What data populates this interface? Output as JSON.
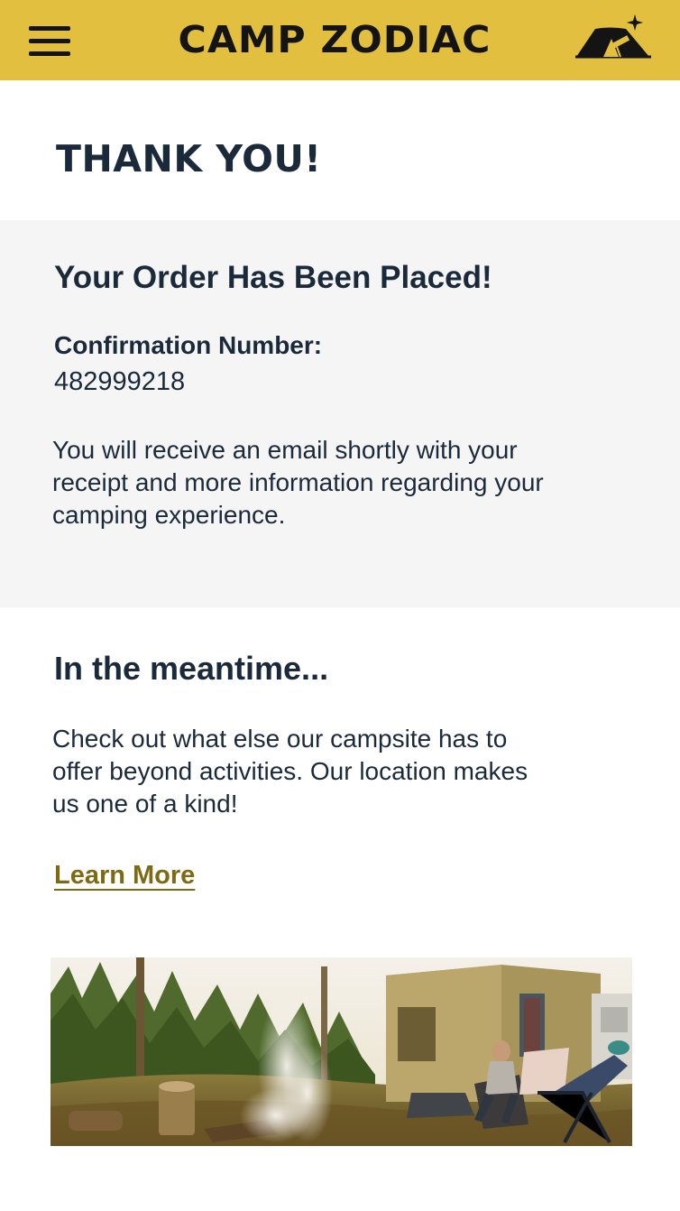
{
  "header": {
    "brand": "CAMP ZODIAC",
    "menu_icon": "hamburger-menu-icon",
    "logo_icon": "tent-telescope-icon",
    "background_color": "#e2bf3e"
  },
  "page": {
    "title": "THANK YOU!"
  },
  "order": {
    "heading": "Your Order Has Been Placed!",
    "confirmation_label": "Confirmation Number:",
    "confirmation_number": "482999218",
    "message": "You will receive an email shortly with your receipt and more information regarding your camping experience.",
    "panel_color": "#f5f5f5"
  },
  "meantime": {
    "heading": "In the meantime...",
    "text": "Check out what else our campsite has to offer beyond activities. Our location makes us one of a kind!",
    "link_label": "Learn More",
    "link_color": "#7d6a14"
  },
  "colors": {
    "text": "#1b2a3b"
  }
}
